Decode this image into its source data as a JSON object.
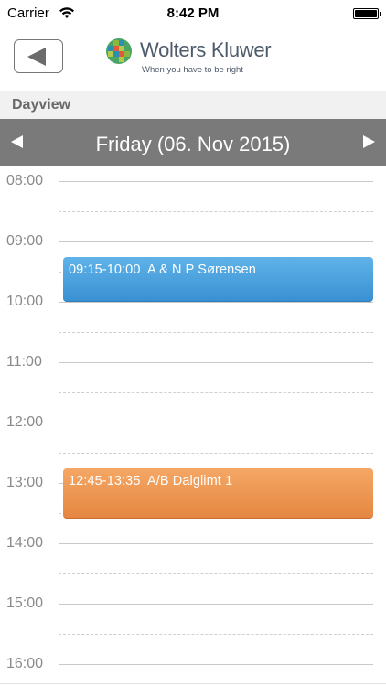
{
  "status_bar": {
    "carrier": "Carrier",
    "time": "8:42 PM",
    "icons": [
      "wifi-icon",
      "battery-icon"
    ]
  },
  "header": {
    "back_icon": "back-arrow-icon",
    "logo": {
      "name": "Wolters Kluwer",
      "tagline": "When you have to be right",
      "colors": [
        "#4aa564",
        "#e05a3c",
        "#8db63c",
        "#2c8fb0",
        "#b4c94a"
      ]
    }
  },
  "section": {
    "title": "Dayview"
  },
  "date_bar": {
    "prev_icon": "triangle-left-icon",
    "next_icon": "triangle-right-icon",
    "title": "Friday  (06. Nov 2015)",
    "background": "#7a7a7a"
  },
  "timeline": {
    "hours": [
      "08:00",
      "09:00",
      "10:00",
      "11:00",
      "12:00",
      "13:00",
      "14:00",
      "15:00",
      "16:00"
    ],
    "events": [
      {
        "time": "09:15-10:00",
        "title": "A & N P Sørensen",
        "color": "#4ba2df"
      },
      {
        "time": "12:45-13:35",
        "title": "A/B Dalglimt 1",
        "color": "#ee9654"
      }
    ]
  }
}
